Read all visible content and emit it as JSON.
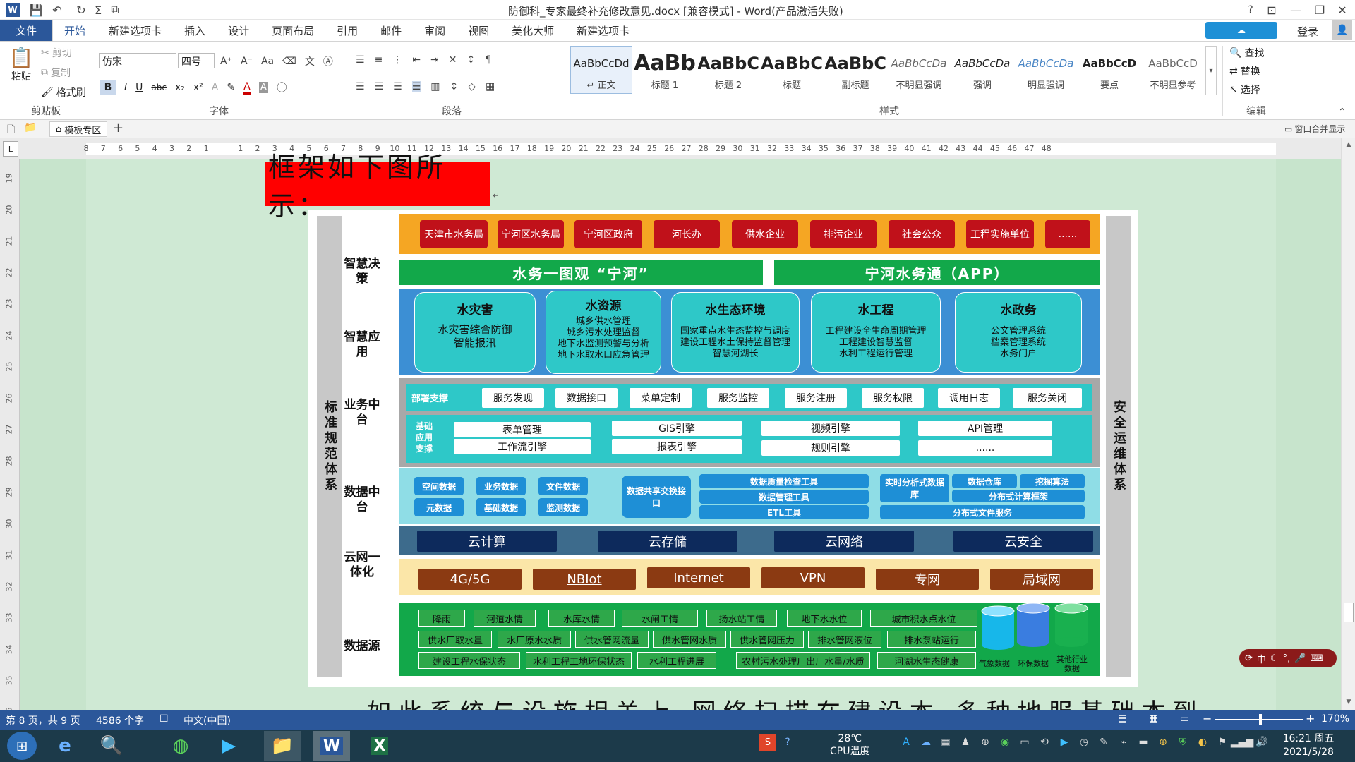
{
  "titlebar": {
    "title": "防御科_专家最终补充修改意见.docx [兼容模式] - Word(产品激活失败)",
    "help": "?",
    "login": "登录"
  },
  "tabs": [
    "文件",
    "开始",
    "新建选项卡",
    "插入",
    "设计",
    "页面布局",
    "引用",
    "邮件",
    "审阅",
    "视图",
    "美化大师",
    "新建选项卡"
  ],
  "ribbon": {
    "clipboard": {
      "paste": "粘贴",
      "cut": "剪切",
      "copy": "复制",
      "format_painter": "格式刷",
      "label": "剪贴板"
    },
    "font": {
      "name": "仿宋",
      "size": "四号",
      "label": "字体"
    },
    "paragraph": {
      "label": "段落"
    },
    "styles": {
      "label": "样式",
      "items": [
        {
          "sample": "AaBbCcDd",
          "name": "↵ 正文"
        },
        {
          "sample": "AaBb",
          "name": "标题 1"
        },
        {
          "sample": "AaBbC",
          "name": "标题 2"
        },
        {
          "sample": "AaBbC",
          "name": "标题"
        },
        {
          "sample": "AaBbC",
          "name": "副标题"
        },
        {
          "sample": "AaBbCcDa",
          "name": "不明显强调"
        },
        {
          "sample": "AaBbCcDa",
          "name": "强调"
        },
        {
          "sample": "AaBbCcDa",
          "name": "明显强调"
        },
        {
          "sample": "AaBbCcD",
          "name": "要点"
        },
        {
          "sample": "AaBbCcD",
          "name": "不明显参考"
        }
      ]
    },
    "editing": {
      "find": "查找",
      "replace": "替换",
      "select": "选择",
      "label": "编辑"
    }
  },
  "docbar": {
    "template": "模板专区",
    "add": "+",
    "merge": "窗口合并显示"
  },
  "ruler": {
    "marks": [
      "8",
      "7",
      "6",
      "5",
      "4",
      "3",
      "2",
      "1",
      "",
      "1",
      "2",
      "3",
      "4",
      "5",
      "6",
      "7",
      "8",
      "9",
      "10",
      "11",
      "12",
      "13",
      "14",
      "15",
      "16",
      "17",
      "18",
      "19",
      "20",
      "21",
      "22",
      "23",
      "24",
      "25",
      "26",
      "27",
      "28",
      "29",
      "30",
      "31",
      "32",
      "33",
      "34",
      "35",
      "36",
      "37",
      "38",
      "39",
      "40",
      "41",
      "42",
      "43",
      "44",
      "45",
      "46",
      "47",
      "48"
    ],
    "vmarks": [
      "19",
      "20",
      "21",
      "22",
      "23",
      "24",
      "25",
      "26",
      "27",
      "28",
      "29",
      "30",
      "31",
      "32",
      "33",
      "34",
      "35",
      "36"
    ]
  },
  "document": {
    "heading": "框架如下图所示：",
    "bottom_text": "如此系统与设施相关上 网络扫描在建设本 多种地服基础本到 各按完成"
  },
  "diagram": {
    "left_bar": "标准规范体系",
    "right_bar": "安全运维体系",
    "layers": {
      "decision": "智慧决策",
      "app": "智慧应用",
      "business": "业务中台",
      "data": "数据中台",
      "cloud": "云网一体化",
      "source": "数据源"
    },
    "users": [
      "天津市水务局",
      "宁河区水务局",
      "宁河区政府",
      "河长办",
      "供水企业",
      "排污企业",
      "社会公众",
      "工程实施单位",
      "......"
    ],
    "decision_items": [
      "水务一图观 “宁河”",
      "宁河水务通（APP）"
    ],
    "apps": [
      {
        "title": "水灾害",
        "lines": [
          "水灾害综合防御",
          "智能报汛"
        ]
      },
      {
        "title": "水资源",
        "lines": [
          "城乡供水管理",
          "城乡污水处理监督",
          "地下水监测预警与分析",
          "地下水取水口应急管理"
        ]
      },
      {
        "title": "水生态环境",
        "lines": [
          "国家重点水生态监控与调度",
          "建设工程水土保持监督管理",
          "智慧河湖长"
        ]
      },
      {
        "title": "水工程",
        "lines": [
          "工程建设全生命周期管理",
          "工程建设智慧监督",
          "水利工程运行管理"
        ]
      },
      {
        "title": "水政务",
        "lines": [
          "公文管理系统",
          "档案管理系统",
          "水务门户"
        ]
      }
    ],
    "business": {
      "deploy_label": "部署支撑",
      "deploy_items": [
        "服务发现",
        "数据接口",
        "菜单定制",
        "服务监控",
        "服务注册",
        "服务权限",
        "调用日志",
        "服务关闭"
      ],
      "base_label": "基础应用支撑",
      "base_items": [
        "表单管理",
        "GIS引擎",
        "视频引擎",
        "API管理",
        "工作流引擎",
        "报表引擎",
        "规则引擎",
        "......"
      ]
    },
    "data_platform": {
      "types": [
        "空间数据",
        "业务数据",
        "文件数据",
        "元数据",
        "基础数据",
        "监测数据"
      ],
      "exchange": "数据共享交换接口",
      "tools": [
        "数据质量检查工具",
        "数据管理工具",
        "ETL工具"
      ],
      "stores": [
        "实时分析式数据库",
        "数据仓库",
        "挖掘算法",
        "分布式计算框架",
        "分布式文件服务"
      ]
    },
    "cloud": [
      "云计算",
      "云存储",
      "云网络",
      "云安全"
    ],
    "network": [
      "4G/5G",
      "NBIot",
      "Internet",
      "VPN",
      "专网",
      "局域网"
    ],
    "sources": {
      "row1": [
        "降雨",
        "河道水情",
        "水库水情",
        "水闸工情",
        "扬水站工情",
        "地下水水位",
        "城市积水点水位"
      ],
      "row2": [
        "供水厂取水量",
        "水厂原水水质",
        "供水管网流量",
        "供水管网水质",
        "供水管网压力",
        "排水管网液位",
        "排水泵站运行"
      ],
      "row3": [
        "建设工程水保状态",
        "水利工程工地环保状态",
        "水利工程进展",
        "农村污水处理厂出厂水量/水质",
        "河湖水生态健康"
      ],
      "cylinders": [
        "气象数据",
        "环保数据",
        "其他行业数据"
      ]
    }
  },
  "status": {
    "page": "第 8 页，共 9 页",
    "words": "4586 个字",
    "lang": "中文(中国)",
    "zoom": "170%"
  },
  "taskbar": {
    "weather_temp": "28℃",
    "weather_label": "CPU温度",
    "time": "16:21 周五",
    "date": "2021/5/28"
  },
  "colors": {
    "accent": "#2b579a",
    "orange": "#f5a623",
    "red_btn": "#c0111a",
    "green": "#12a84a",
    "blue_layer": "#3c8fd4",
    "teal": "#2ec8c8",
    "light_teal": "#7fd6e0",
    "navy": "#0d2a5c",
    "cloud_bg": "#3d6b8c",
    "brown": "#8b3a12",
    "net_bg": "#fbe6a8",
    "workspace": "#c7e4cc"
  }
}
